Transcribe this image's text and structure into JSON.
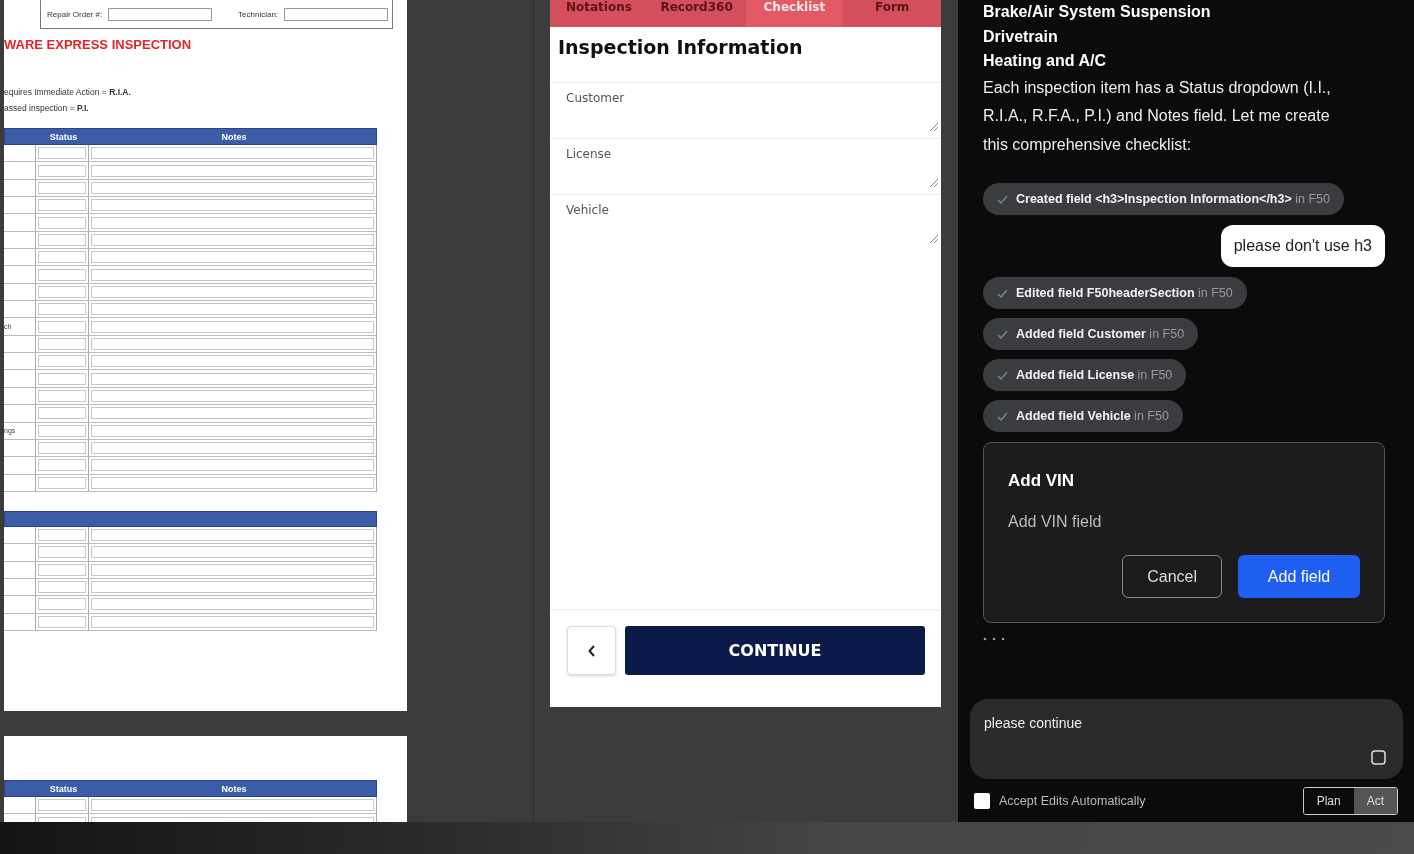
{
  "pdf": {
    "page_1": {
      "header_fields": [
        {
          "label": "Repair Order #:"
        },
        {
          "label": "Technician:"
        }
      ],
      "title": "WARE EXPRESS INSPECTION",
      "legend": [
        "equires Immediate Action = **R.I.A.**",
        "assed inspection = **P.I.**"
      ],
      "tables": [
        {
          "columns": [
            "Status",
            "Notes"
          ],
          "rows": [
            {},
            {},
            {},
            {},
            {},
            {},
            {},
            {},
            {},
            {},
            {
              "label": "ch"
            },
            {},
            {},
            {},
            {},
            {},
            {
              "label": "ngs"
            },
            {},
            {},
            {}
          ]
        },
        {
          "rows": [
            {},
            {},
            {},
            {},
            {},
            {}
          ]
        }
      ]
    },
    "page_2": {
      "tables": [
        {
          "columns": [
            "Status",
            "Notes"
          ],
          "rows": [
            {},
            {}
          ]
        }
      ]
    }
  },
  "preview": {
    "tabs": [
      {
        "label": "Notations",
        "selected": false
      },
      {
        "label": "Record360",
        "selected": false
      },
      {
        "label": "Checklist",
        "selected": true
      },
      {
        "label": "Form",
        "selected": false
      }
    ],
    "form_title": "Inspection Information",
    "fields": [
      {
        "label": "Customer"
      },
      {
        "label": "License"
      },
      {
        "label": "Vehicle"
      }
    ],
    "continue_button": "CONTINUE"
  },
  "chat": {
    "headings": [
      "Brake/Air System Suspension",
      "Drivetrain",
      "Heating and A/C"
    ],
    "paragraph": "Each inspection item has a Status dropdown (I.I., R.I.A., R.F.A., P.I.) and Notes field. Let me create this comprehensive checklist:",
    "messages": [
      {
        "kind": "chip",
        "action": "Created field <h3>Inspection Information</h3>",
        "target": "in F50"
      },
      {
        "kind": "user",
        "text": "please don't use h3"
      },
      {
        "kind": "chip",
        "action": "Edited field F50headerSection",
        "target": "in F50"
      },
      {
        "kind": "chip",
        "action": "Added field Customer",
        "target": "in F50"
      },
      {
        "kind": "chip",
        "action": "Added field License",
        "target": "in F50"
      },
      {
        "kind": "chip",
        "action": "Added field Vehicle",
        "target": "in F50"
      },
      {
        "kind": "approval",
        "title": "Add VIN",
        "description": "Add VIN field",
        "buttons": [
          {
            "label": "Cancel",
            "kind": "secondary"
          },
          {
            "label": "Add field",
            "kind": "primary"
          }
        ]
      },
      {
        "kind": "typing"
      }
    ],
    "composer": {
      "value": "please continue"
    },
    "auto_accept": {
      "label": "Accept Edits Automatically",
      "checked": false
    },
    "modes": [
      {
        "label": "Plan",
        "selected": false
      },
      {
        "label": "Act",
        "selected": true
      }
    ]
  }
}
